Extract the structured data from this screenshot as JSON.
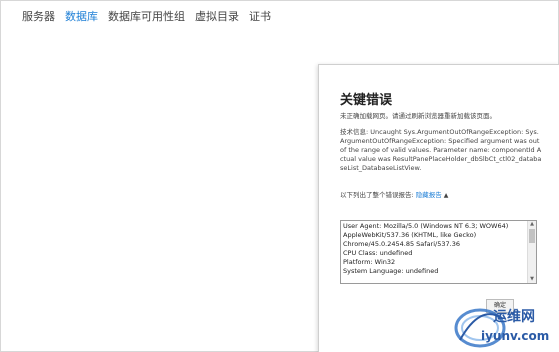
{
  "nav": {
    "items": [
      {
        "label": "服务器",
        "active": false
      },
      {
        "label": "数据库",
        "active": true
      },
      {
        "label": "数据库可用性组",
        "active": false
      },
      {
        "label": "虚拟目录",
        "active": false
      },
      {
        "label": "证书",
        "active": false
      }
    ]
  },
  "error": {
    "title": "关键错误",
    "message": "未正确加载网页。请通过刷新浏览器重新加载该页面。",
    "detail": "技术信息: Uncaught Sys.ArgumentOutOfRangeException: Sys.ArgumentOutOfRangeException: Specified argument was out of the range of valid values. Parameter name: componentId Actual value was ResultPanePlaceHolder_dbSlbCt_ctl02_databaseList_DatabaseListView.",
    "report_prefix": "以下列出了整个错误报告: ",
    "report_link": "隐藏报告",
    "report_lines": [
      "User Agent: Mozilla/5.0 (Windows NT 6.3; WOW64)",
      "AppleWebKit/537.36 (KHTML, like Gecko)",
      "Chrome/45.0.2454.85 Safari/537.36",
      "CPU Class: undefined",
      "Platform: Win32",
      "System Language: undefined"
    ],
    "ok_button": "确定"
  },
  "watermark": {
    "text": "运维网",
    "url": "iyunv.com"
  },
  "colors": {
    "accent": "#1e7fd6",
    "watermark": "#2a5aa6"
  }
}
